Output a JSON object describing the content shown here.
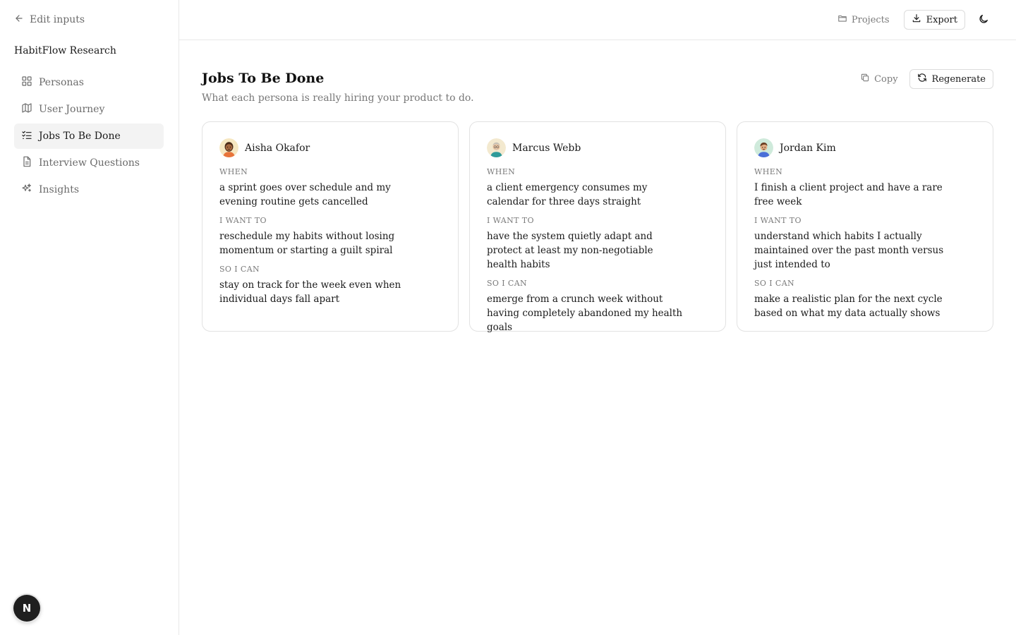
{
  "sidebar": {
    "back_label": "Edit inputs",
    "project_name": "HabitFlow Research",
    "items": [
      {
        "label": "Personas",
        "icon": "grid-icon",
        "active": false
      },
      {
        "label": "User Journey",
        "icon": "map-icon",
        "active": false
      },
      {
        "label": "Jobs To Be Done",
        "icon": "list-checks-icon",
        "active": true
      },
      {
        "label": "Interview Questions",
        "icon": "document-icon",
        "active": false
      },
      {
        "label": "Insights",
        "icon": "sparkles-icon",
        "active": false
      }
    ],
    "badge_label": "N"
  },
  "topbar": {
    "projects_label": "Projects",
    "export_label": "Export"
  },
  "page": {
    "title": "Jobs To Be Done",
    "subtitle": "What each persona is really hiring your product to do.",
    "copy_label": "Copy",
    "regenerate_label": "Regenerate"
  },
  "labels": {
    "when": "WHEN",
    "want": "I WANT TO",
    "so": "SO I CAN"
  },
  "cards": [
    {
      "name": "Aisha Okafor",
      "avatar_bg": "#f6e7c1",
      "when": "a sprint goes over schedule and my evening routine gets cancelled",
      "want": "reschedule my habits without losing momentum or starting a guilt spiral",
      "so": "stay on track for the week even when individual days fall apart"
    },
    {
      "name": "Marcus Webb",
      "avatar_bg": "#f3e9cf",
      "when": "a client emergency consumes my calendar for three days straight",
      "want": "have the system quietly adapt and protect at least my non-negotiable health habits",
      "so": "emerge from a crunch week without having completely abandoned my health goals"
    },
    {
      "name": "Jordan Kim",
      "avatar_bg": "#cfeadb",
      "when": "I finish a client project and have a rare free week",
      "want": "understand which habits I actually maintained over the past month versus just intended to",
      "so": "make a realistic plan for the next cycle based on what my data actually shows"
    }
  ]
}
